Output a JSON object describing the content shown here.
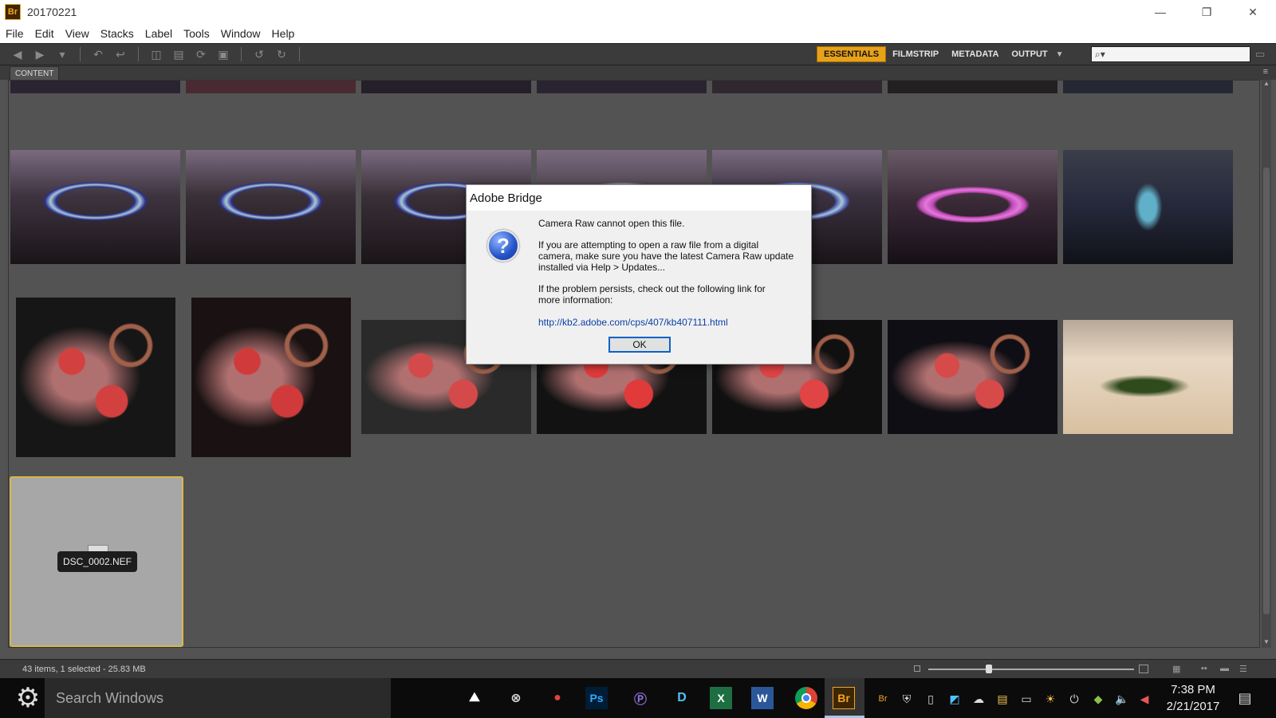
{
  "window": {
    "title": "20170221",
    "app_icon": "Br"
  },
  "menu": [
    "File",
    "Edit",
    "View",
    "Stacks",
    "Label",
    "Tools",
    "Window",
    "Help"
  ],
  "workspaces": [
    {
      "label": "ESSENTIALS",
      "active": true
    },
    {
      "label": "FILMSTRIP",
      "active": false
    },
    {
      "label": "METADATA",
      "active": false
    },
    {
      "label": "OUTPUT",
      "active": false
    }
  ],
  "panel": {
    "tab": "CONTENT"
  },
  "thumbnails": [
    {
      "row": 0,
      "col": 0,
      "bg": "#2a2430",
      "accent": "#4a3fa0",
      "subject": "bracelet-top"
    },
    {
      "row": 0,
      "col": 1,
      "bg": "#4a2a32",
      "accent": "#6a3a44",
      "subject": "bracelet-top"
    },
    {
      "row": 0,
      "col": 2,
      "bg": "#241f28",
      "accent": "#3f4f52",
      "subject": "bracelet-top"
    },
    {
      "row": 0,
      "col": 3,
      "bg": "#2a2432",
      "accent": "#5845b8",
      "subject": "bracelet-top"
    },
    {
      "row": 0,
      "col": 4,
      "bg": "#2f282e",
      "accent": "#4a3a44",
      "subject": "bracelet-top"
    },
    {
      "row": 0,
      "col": 5,
      "bg": "#232022",
      "accent": "#4a4a4a",
      "subject": "bracelet-top"
    },
    {
      "row": 0,
      "col": 6,
      "bg": "#252833",
      "accent": "#58c0c8",
      "subject": "bracelet-top"
    },
    {
      "row": 1,
      "col": 0,
      "bg": "#3e3440",
      "accent": "#2c2f8a",
      "subject": "blue-bracelet"
    },
    {
      "row": 1,
      "col": 1,
      "bg": "#3a3038",
      "accent": "#2c2f8a",
      "subject": "blue-bracelet"
    },
    {
      "row": 1,
      "col": 2,
      "bg": "#3a3038",
      "accent": "#2c2f8a",
      "subject": "blue-bracelet"
    },
    {
      "row": 1,
      "col": 3,
      "bg": "#4a4048",
      "accent": "#6a6070",
      "subject": "blue-bracelet"
    },
    {
      "row": 1,
      "col": 4,
      "bg": "#3a3240",
      "accent": "#4a56a8",
      "subject": "blue-bracelet"
    },
    {
      "row": 1,
      "col": 5,
      "bg": "#3a2a38",
      "accent": "#c24ab8",
      "subject": "pink-bracelet"
    },
    {
      "row": 1,
      "col": 6,
      "bg": "#25283a",
      "accent": "#5fb0c8",
      "subject": "teal-bracelet"
    },
    {
      "row": 2,
      "col": 0,
      "bg": "#161616",
      "accent": "#d24040",
      "subject": "red-beads"
    },
    {
      "row": 2,
      "col": 1,
      "bg": "#1a1212",
      "accent": "#d03a3a",
      "subject": "red-beads"
    },
    {
      "row": 2,
      "col": 2,
      "bg": "#2a2a2a",
      "accent": "#d44a4a",
      "subject": "red-beads"
    },
    {
      "row": 2,
      "col": 3,
      "bg": "#121212",
      "accent": "#e03a3a",
      "subject": "red-beads"
    },
    {
      "row": 2,
      "col": 4,
      "bg": "#101010",
      "accent": "#e04444",
      "subject": "red-beads"
    },
    {
      "row": 2,
      "col": 5,
      "bg": "#0e0e14",
      "accent": "#d64a4a",
      "subject": "red-beads"
    },
    {
      "row": 2,
      "col": 6,
      "bg": "#e8d8c4",
      "accent": "#2f4a1c",
      "subject": "green-bracelet"
    }
  ],
  "selected_file": {
    "name": "DSC_0002.NEF"
  },
  "status": {
    "text": "43 items, 1 selected - 25.83 MB"
  },
  "dialog": {
    "title": "Adobe Bridge",
    "icon": "question-icon",
    "line1": "Camera Raw cannot open this file.",
    "para2_line1": "If you are attempting to open a raw file from a digital",
    "para2_line2": "camera, make sure you have the latest Camera Raw update",
    "para2_line3": "installed via Help > Updates...",
    "para3_line1": "If the problem persists, check out the following link for",
    "para3_line2": "more information:",
    "link": "http://kb2.adobe.com/cps/407/kb407111.html",
    "ok_label": "OK"
  },
  "taskbar": {
    "search_placeholder": "Search Windows",
    "time": "7:38 PM",
    "date": "2/21/2017"
  },
  "colors": {
    "accent_workspace": "#e7a21a",
    "panel_bg": "#535353",
    "selection_border": "#d8b64a"
  }
}
